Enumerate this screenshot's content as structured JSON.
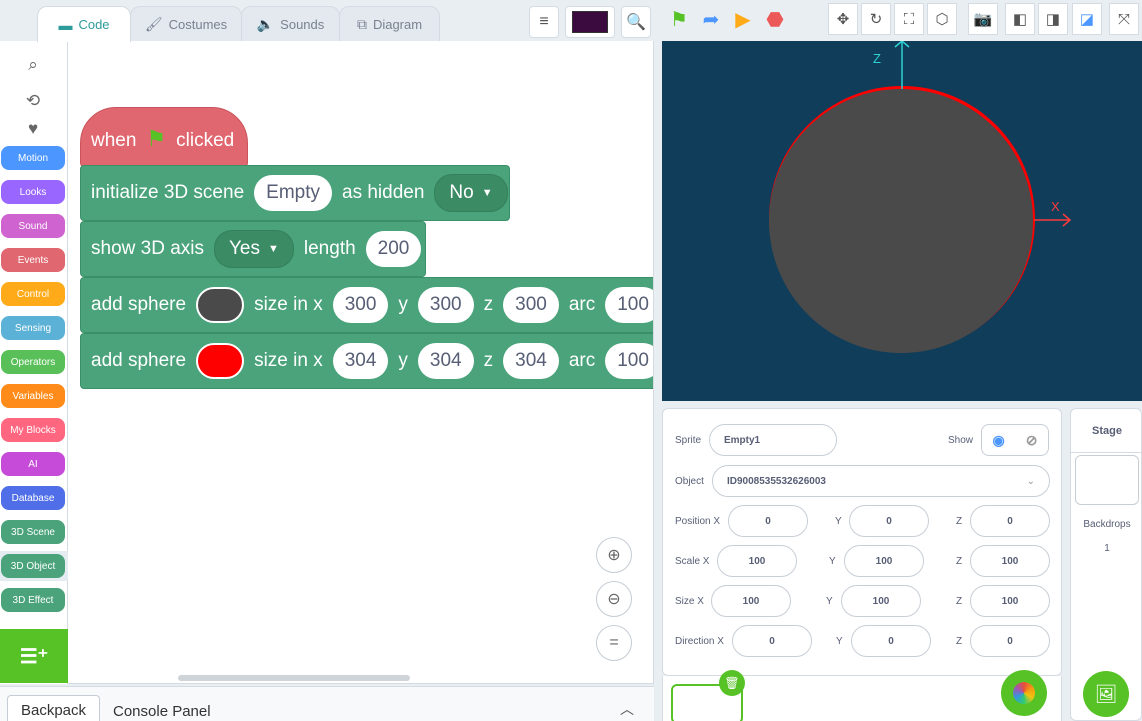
{
  "tabs": [
    {
      "label": "Code",
      "icon": "code-icon"
    },
    {
      "label": "Costumes",
      "icon": "brush-icon"
    },
    {
      "label": "Sounds",
      "icon": "speaker-icon"
    },
    {
      "label": "Diagram",
      "icon": "diagram-icon"
    }
  ],
  "toolbar": {
    "align_icon": "align-left-icon",
    "search_icon": "search-icon",
    "selected_color": "#3b0a3f"
  },
  "categories": [
    {
      "label": "Motion",
      "color": "#4c97ff"
    },
    {
      "label": "Looks",
      "color": "#9966ff"
    },
    {
      "label": "Sound",
      "color": "#cf63cf"
    },
    {
      "label": "Events",
      "color": "#e0666f"
    },
    {
      "label": "Control",
      "color": "#ffab19"
    },
    {
      "label": "Sensing",
      "color": "#5cb1d6"
    },
    {
      "label": "Operators",
      "color": "#59c059"
    },
    {
      "label": "Variables",
      "color": "#ff8c1a"
    },
    {
      "label": "My Blocks",
      "color": "#ff6680"
    },
    {
      "label": "AI",
      "color": "#c54bd8"
    },
    {
      "label": "Database",
      "color": "#4f6ee8"
    },
    {
      "label": "3D Scene",
      "color": "#4aa37b"
    },
    {
      "label": "3D Object",
      "color": "#4aa37b"
    },
    {
      "label": "3D Effect",
      "color": "#4aa37b"
    }
  ],
  "script": {
    "hat": {
      "when": "when",
      "clicked": "clicked"
    },
    "init": {
      "label": "initialize 3D scene",
      "scene": "Empty",
      "hidden_label": "as hidden",
      "hidden_value": "No"
    },
    "axis": {
      "label": "show 3D axis",
      "value": "Yes",
      "length_label": "length",
      "length": "200"
    },
    "sphere1": {
      "label": "add sphere",
      "color": "#4a4a4a",
      "size_label": "size in x",
      "x": "300",
      "y_label": "y",
      "y": "300",
      "z_label": "z",
      "z": "300",
      "arc_label": "arc",
      "arc": "100"
    },
    "sphere2": {
      "label": "add sphere",
      "color": "#ff0000",
      "size_label": "size in x",
      "x": "304",
      "y_label": "y",
      "y": "304",
      "z_label": "z",
      "z": "304",
      "arc_label": "arc",
      "arc": "100"
    }
  },
  "bottom": {
    "backpack": "Backpack",
    "console": "Console Panel"
  },
  "stage": {
    "axis_z": "Z",
    "axis_x": "X",
    "background": "#0f3d5a"
  },
  "sprite": {
    "sprite_label": "Sprite",
    "sprite_name": "Empty1",
    "show_label": "Show",
    "object_label": "Object",
    "object_id": "ID9008535532626003",
    "position": {
      "label": "Position X",
      "x": "0",
      "y_label": "Y",
      "y": "0",
      "z_label": "Z",
      "z": "0"
    },
    "scale": {
      "label": "Scale X",
      "x": "100",
      "y_label": "Y",
      "y": "100",
      "z_label": "Z",
      "z": "100"
    },
    "size": {
      "label": "Size X",
      "x": "100",
      "y_label": "Y",
      "y": "100",
      "z_label": "Z",
      "z": "100"
    },
    "direction": {
      "label": "Direction X",
      "x": "0",
      "y_label": "Y",
      "y": "0",
      "z_label": "Z",
      "z": "0"
    }
  },
  "stage_panel": {
    "title": "Stage",
    "backdrops_label": "Backdrops",
    "backdrops_count": "1"
  }
}
